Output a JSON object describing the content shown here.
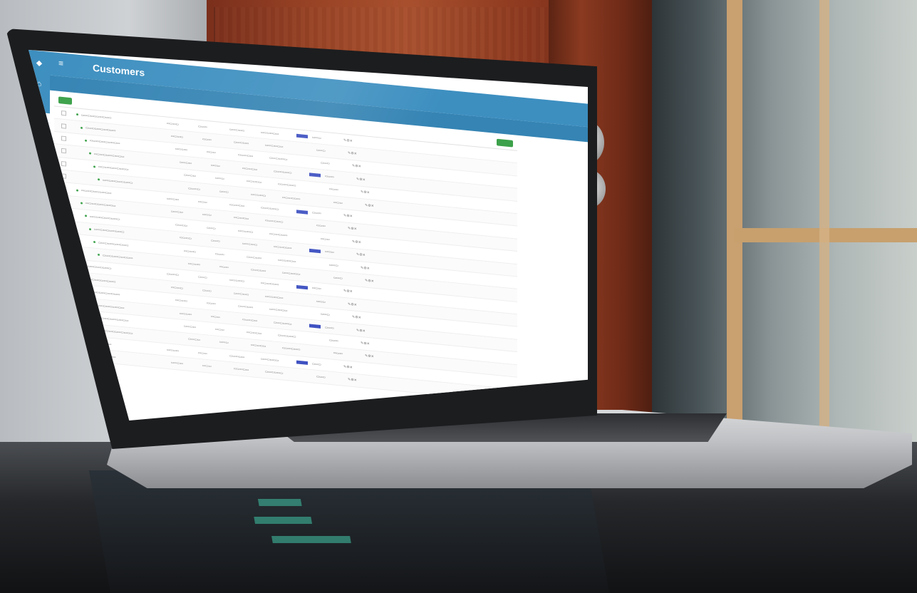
{
  "app": {
    "title": "Customers"
  },
  "colors": {
    "header_blue": "#3d8fc0",
    "action_green": "#3ca14a",
    "badge_indigo": "#3b4ec0",
    "active_red": "#d73b3b"
  },
  "icons": {
    "sidebar": [
      "home-icon",
      "phone-icon",
      "inbox-icon",
      "chart-icon",
      "users-icon"
    ],
    "menu": "hamburger-icon"
  }
}
